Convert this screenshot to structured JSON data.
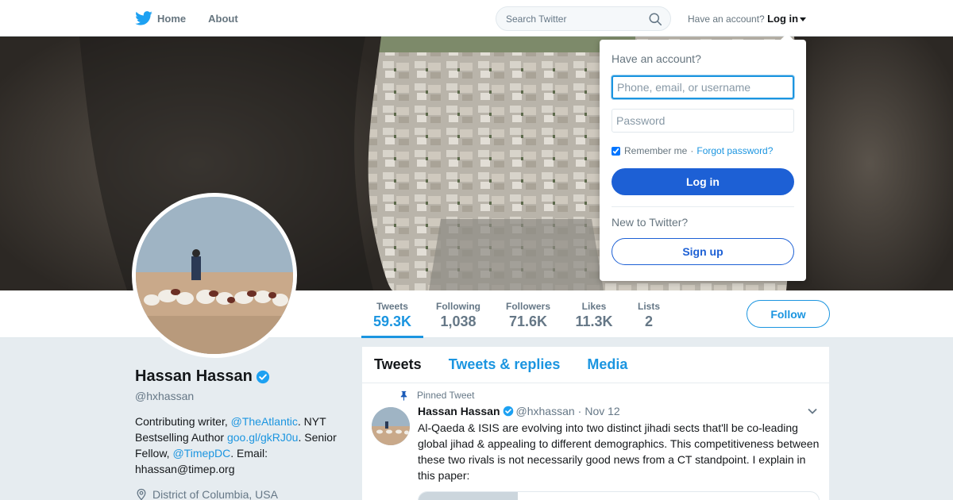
{
  "nav": {
    "home_label": "Home",
    "about_label": "About",
    "search_placeholder": "Search Twitter",
    "have_account": "Have an account?",
    "login_label": "Log in"
  },
  "profile": {
    "name": "Hassan Hassan",
    "handle": "@hxhassan",
    "bio_1": "Contributing writer, ",
    "bio_link_1": "@TheAtlantic",
    "bio_2": ". NYT Bestselling Author ",
    "bio_link_2": "goo.gl/gkRJ0u",
    "bio_3": ". Senior Fellow, ",
    "bio_link_3": "@TimepDC",
    "bio_4": ". Email: hhassan@timep.org",
    "location": "District of Columbia, USA"
  },
  "stats": [
    {
      "label": "Tweets",
      "value": "59.3K"
    },
    {
      "label": "Following",
      "value": "1,038"
    },
    {
      "label": "Followers",
      "value": "71.6K"
    },
    {
      "label": "Likes",
      "value": "11.3K"
    },
    {
      "label": "Lists",
      "value": "2"
    }
  ],
  "follow_label": "Follow",
  "timeline": {
    "tabs": [
      "Tweets",
      "Tweets & replies",
      "Media"
    ],
    "tweet": {
      "pinned_label": "Pinned Tweet",
      "name": "Hassan Hassan",
      "handle": "@hxhassan",
      "dot": "·",
      "date": "Nov 12",
      "text": "Al-Qaeda & ISIS are evolving into two distinct jihadi sects that'll be co-leading global jihad & appealing to different demographics. This competitiveness between these two rivals is not necessarily good news from a CT standpoint. I explain in this paper:"
    }
  },
  "login_dropdown": {
    "title": "Have an account?",
    "username_placeholder": "Phone, email, or username",
    "password_placeholder": "Password",
    "remember_label": "Remember me",
    "separator": "·",
    "forgot_label": "Forgot password?",
    "login_button": "Log in",
    "new_label": "New to Twitter?",
    "signup_button": "Sign up"
  },
  "colors": {
    "accent": "#1b95e0",
    "login_button": "#1d60d5",
    "background": "#e6ecf0"
  }
}
